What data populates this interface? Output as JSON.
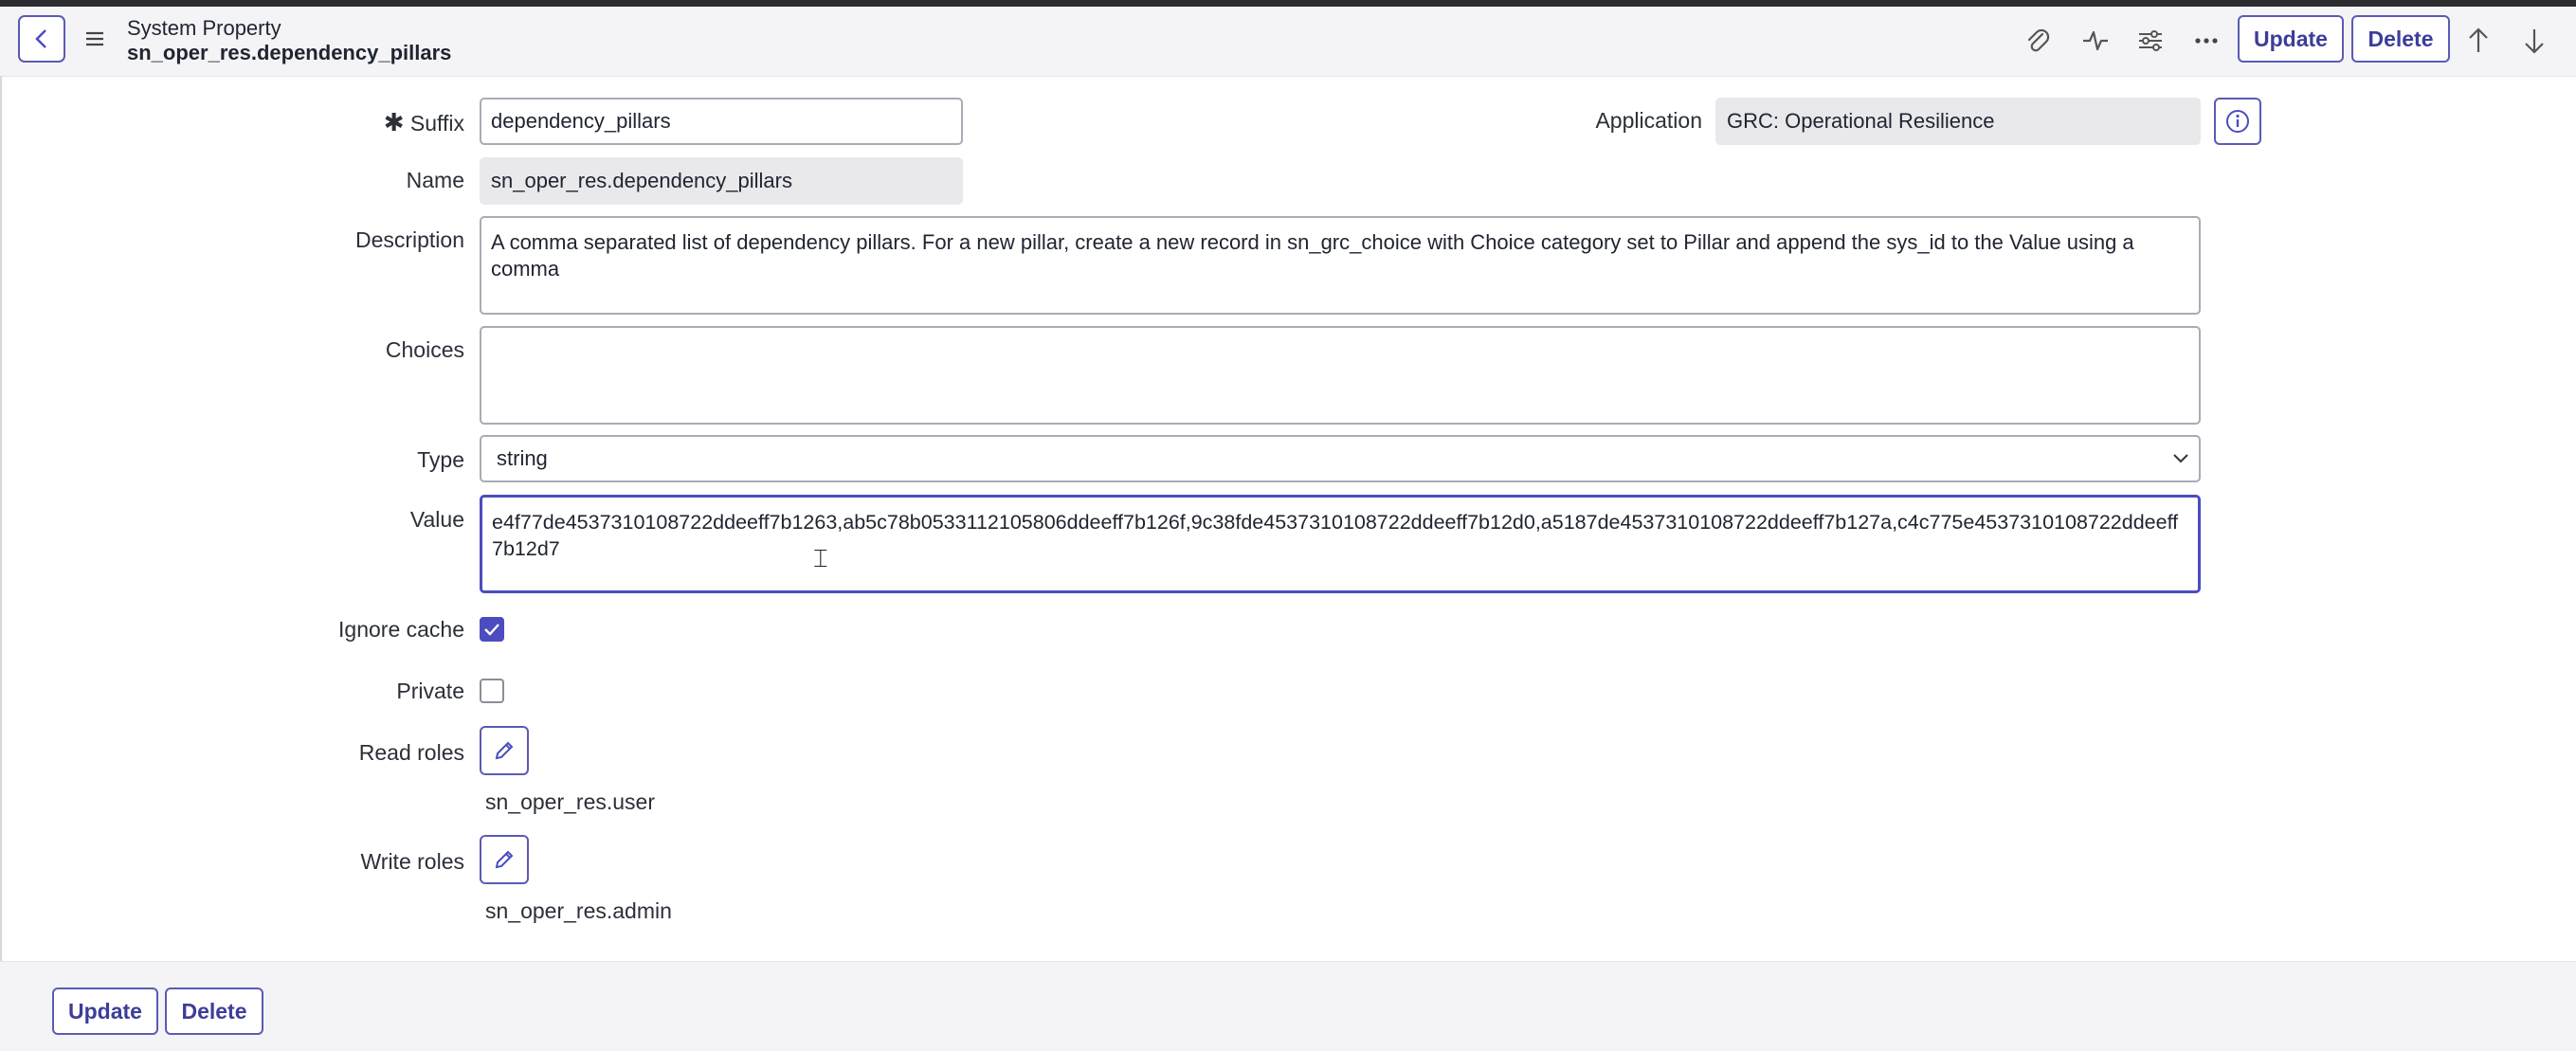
{
  "header": {
    "title": "System Property",
    "subtitle": "sn_oper_res.dependency_pillars",
    "update_label": "Update",
    "delete_label": "Delete"
  },
  "form": {
    "suffix_label": "Suffix",
    "suffix_value": "dependency_pillars",
    "application_label": "Application",
    "application_value": "GRC: Operational Resilience",
    "name_label": "Name",
    "name_value": "sn_oper_res.dependency_pillars",
    "description_label": "Description",
    "description_value": "A comma separated list of dependency pillars. For a new pillar, create a new record in sn_grc_choice with Choice category set to Pillar and append the sys_id to the Value using a comma",
    "choices_label": "Choices",
    "choices_value": "",
    "type_label": "Type",
    "type_value": "string",
    "value_label": "Value",
    "value_value": "e4f77de4537310108722ddeeff7b1263,ab5c78b0533112105806ddeeff7b126f,9c38fde4537310108722ddeeff7b12d0,a5187de4537310108722ddeeff7b127a,c4c775e4537310108722ddeeff7b12d7",
    "ignore_cache_label": "Ignore cache",
    "ignore_cache_checked": true,
    "private_label": "Private",
    "private_checked": false,
    "read_roles_label": "Read roles",
    "read_roles_value": "sn_oper_res.user",
    "write_roles_label": "Write roles",
    "write_roles_value": "sn_oper_res.admin"
  },
  "footer": {
    "update_label": "Update",
    "delete_label": "Delete"
  },
  "icons": {
    "back": "chevron-left-icon",
    "menu": "hamburger-icon",
    "attachment": "paperclip-icon",
    "activity": "activity-icon",
    "personalize": "sliders-icon",
    "more": "ellipsis-icon",
    "prev": "arrow-up-icon",
    "next": "arrow-down-icon",
    "info": "info-icon",
    "edit": "pencil-icon"
  },
  "colors": {
    "accent": "#4b4cc0",
    "button_text": "#3c3d9a",
    "readonly_bg": "#e9e9ec"
  }
}
